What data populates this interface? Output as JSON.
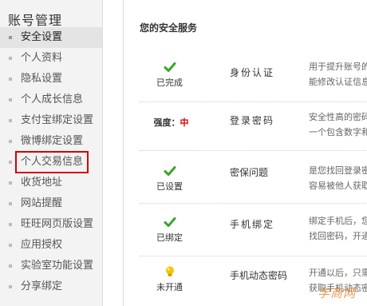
{
  "sidebar": {
    "title": "账号管理",
    "items": [
      {
        "label": "安全设置"
      },
      {
        "label": "个人资料"
      },
      {
        "label": "隐私设置"
      },
      {
        "label": "个人成长信息"
      },
      {
        "label": "支付宝绑定设置"
      },
      {
        "label": "微博绑定设置"
      },
      {
        "label": "个人交易信息"
      },
      {
        "label": "收货地址"
      },
      {
        "label": "网站提醒"
      },
      {
        "label": "旺旺网页版设置"
      },
      {
        "label": "应用授权"
      },
      {
        "label": "实验室功能设置"
      },
      {
        "label": "分享绑定"
      }
    ],
    "active_index": 0,
    "highlighted_index": 6
  },
  "main": {
    "title": "您的安全服务",
    "services": [
      {
        "status": "已完成",
        "icon": "check-icon",
        "name": "身份认证",
        "desc": [
          "用于提升账号的",
          "能修改认证信息"
        ]
      },
      {
        "status_label": "强度：",
        "status_value": "中",
        "name": "登录密码",
        "desc": [
          "安全性高的密码",
          "一个包含数字和"
        ]
      },
      {
        "status": "已设置",
        "icon": "check-icon",
        "name": "密保问题",
        "desc": [
          "是您找回登录密",
          "容易被他人获取"
        ]
      },
      {
        "status": "已绑定",
        "icon": "check-icon",
        "name": "手机绑定",
        "desc": [
          "绑定手机后，您",
          "找回密码，开通"
        ]
      },
      {
        "status": "未开通",
        "icon": "lightbulb-icon",
        "name": "手机动态密码",
        "desc": [
          "开通以后，只需",
          "获取手机动态密"
        ]
      }
    ]
  },
  "colors": {
    "check": "#3aa52a",
    "highlight": "#d40000",
    "bulb": "#f5c400"
  },
  "watermark": "学商网"
}
